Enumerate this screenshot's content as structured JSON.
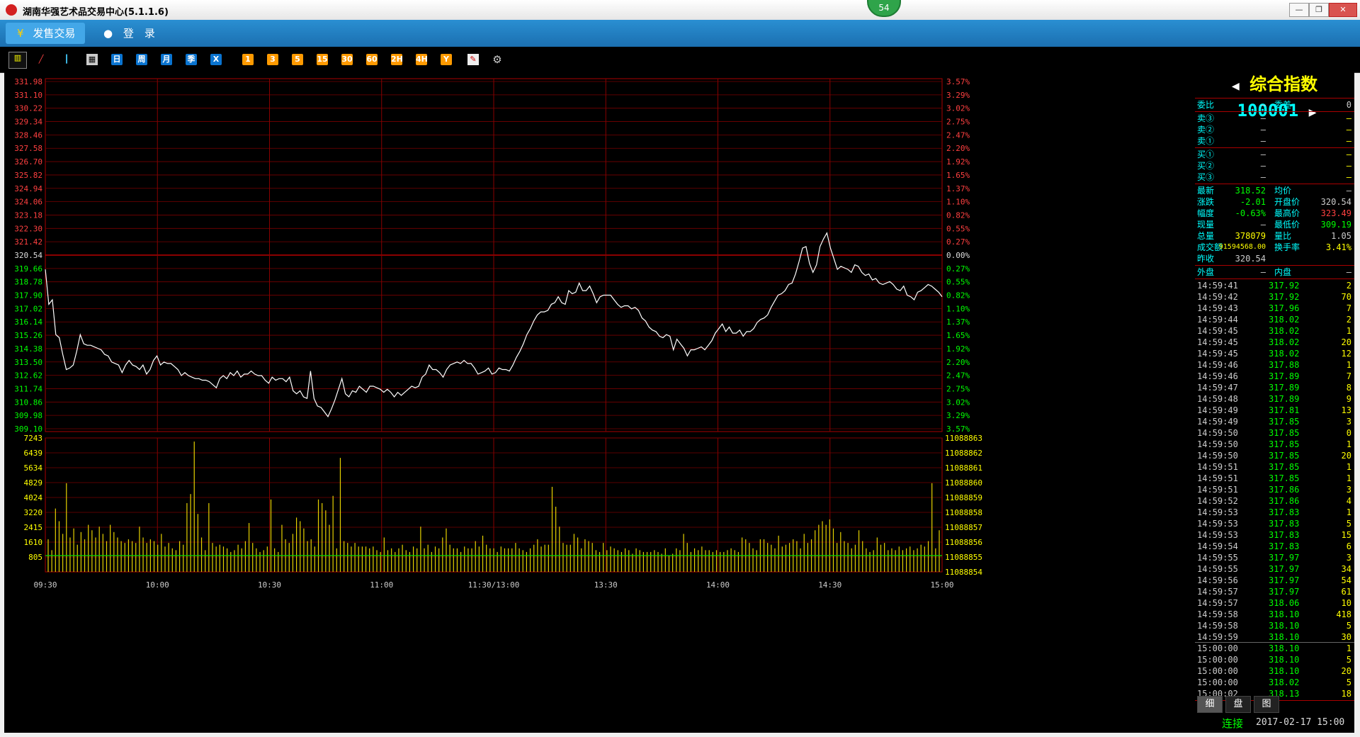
{
  "window": {
    "title": "湖南华强艺术品交易中心(5.1.1.6)",
    "badge": "54"
  },
  "menu": {
    "items": [
      "发售交易",
      "登　录"
    ]
  },
  "toolbar": {
    "period_buttons": [
      "日",
      "周",
      "月",
      "季",
      "X"
    ],
    "minute_buttons": [
      "1",
      "3",
      "5",
      "15",
      "30",
      "60",
      "2H",
      "4H",
      "Y"
    ]
  },
  "chart_data": {
    "type": "line",
    "title": "",
    "x_ticks": [
      "09:30",
      "10:00",
      "10:30",
      "11:00",
      "11:30/13:00",
      "13:30",
      "14:00",
      "14:30",
      "15:00"
    ],
    "price_left_ticks": [
      "331.98",
      "331.10",
      "330.22",
      "329.34",
      "328.46",
      "327.58",
      "326.70",
      "325.82",
      "324.94",
      "324.06",
      "323.18",
      "322.30",
      "321.42",
      "320.54",
      "319.66",
      "318.78",
      "317.90",
      "317.02",
      "316.14",
      "315.26",
      "314.38",
      "313.50",
      "312.62",
      "311.74",
      "310.86",
      "309.98",
      "309.10"
    ],
    "pct_right_ticks": [
      "3.57%",
      "3.29%",
      "3.02%",
      "2.75%",
      "2.47%",
      "2.20%",
      "1.92%",
      "1.65%",
      "1.37%",
      "1.10%",
      "0.82%",
      "0.55%",
      "0.27%",
      "0.00%",
      "0.27%",
      "0.55%",
      "0.82%",
      "1.10%",
      "1.37%",
      "1.65%",
      "1.92%",
      "2.20%",
      "2.47%",
      "2.75%",
      "3.02%",
      "3.29%",
      "3.57%"
    ],
    "vol_left_ticks": [
      "7243",
      "6439",
      "5634",
      "4829",
      "4024",
      "3220",
      "2415",
      "1610",
      "805"
    ],
    "vol_right_ticks": [
      "11088863",
      "11088862",
      "11088861",
      "11088860",
      "11088859",
      "11088858",
      "11088857",
      "11088856",
      "11088855",
      "11088854"
    ],
    "ylim": [
      309.1,
      331.98
    ],
    "prev_close": 320.54,
    "price": [
      319.6,
      317.3,
      317.6,
      315.3,
      315.1,
      314.0,
      313.0,
      313.1,
      313.3,
      314.2,
      315.3,
      314.7,
      314.6,
      314.6,
      314.5,
      314.4,
      314.3,
      314.0,
      313.9,
      313.5,
      313.4,
      313.3,
      312.8,
      313.3,
      313.6,
      313.3,
      313.2,
      313.0,
      313.3,
      312.7,
      313.0,
      313.6,
      313.9,
      313.3,
      313.5,
      313.4,
      313.4,
      313.2,
      313.0,
      312.6,
      312.8,
      312.6,
      312.5,
      312.4,
      312.4,
      312.3,
      312.3,
      312.2,
      312.0,
      311.8,
      312.4,
      312.6,
      312.4,
      312.8,
      312.6,
      312.9,
      312.5,
      312.7,
      312.7,
      312.9,
      312.7,
      312.6,
      312.6,
      312.3,
      312.1,
      312.5,
      312.3,
      312.4,
      312.4,
      312.2,
      312.5,
      311.6,
      311.4,
      311.6,
      311.2,
      311.1,
      312.9,
      311.1,
      310.6,
      310.5,
      310.2,
      309.9,
      310.4,
      311.0,
      311.7,
      312.4,
      311.4,
      311.2,
      311.6,
      311.5,
      311.9,
      311.7,
      311.5,
      311.9,
      311.9,
      311.8,
      311.7,
      311.5,
      311.7,
      311.5,
      311.2,
      311.5,
      311.3,
      311.5,
      311.7,
      311.9,
      311.8,
      311.9,
      312.5,
      312.7,
      313.3,
      313.0,
      313.0,
      312.8,
      312.5,
      313.0,
      313.3,
      313.4,
      313.5,
      313.4,
      313.6,
      313.4,
      313.4,
      313.1,
      312.7,
      312.8,
      312.9,
      313.1,
      312.7,
      312.8,
      313.1,
      313.0,
      313.0,
      312.9,
      313.3,
      313.8,
      314.2,
      314.7,
      315.3,
      315.7,
      316.2,
      316.6,
      316.8,
      316.8,
      316.9,
      317.3,
      317.4,
      317.8,
      317.4,
      317.3,
      318.2,
      318.0,
      318.1,
      318.7,
      318.2,
      318.2,
      318.5,
      318.0,
      317.4,
      317.8,
      317.9,
      317.9,
      317.9,
      317.6,
      317.3,
      317.1,
      317.2,
      317.2,
      317.0,
      317.1,
      316.9,
      316.4,
      316.2,
      315.8,
      315.6,
      315.5,
      315.2,
      315.1,
      315.3,
      315.2,
      314.3,
      315.0,
      314.7,
      314.4,
      313.9,
      314.3,
      314.3,
      314.4,
      314.5,
      314.3,
      314.6,
      314.9,
      315.4,
      315.7,
      316.0,
      315.5,
      315.8,
      315.4,
      315.4,
      315.6,
      315.2,
      315.5,
      315.5,
      315.7,
      316.1,
      316.3,
      316.4,
      316.6,
      317.1,
      317.5,
      317.9,
      318.0,
      318.2,
      318.6,
      318.7,
      319.3,
      320.1,
      321.0,
      321.1,
      320.0,
      319.4,
      319.9,
      321.1,
      321.6,
      322.0,
      321.0,
      320.3,
      319.6,
      319.8,
      319.7,
      319.6,
      319.4,
      319.9,
      319.8,
      319.4,
      319.2,
      319.3,
      318.9,
      319.0,
      318.7,
      318.6,
      318.7,
      318.8,
      318.6,
      318.3,
      318.2,
      318.5,
      317.9,
      317.8,
      317.6,
      318.1,
      318.2,
      318.4,
      318.6,
      318.5,
      318.3,
      318.1,
      317.8
    ],
    "volume": [
      1800,
      1200,
      3500,
      2800,
      2100,
      4900,
      1900,
      2400,
      1500,
      2200,
      1800,
      2600,
      2300,
      1900,
      2500,
      2100,
      1700,
      2600,
      2200,
      1900,
      1700,
      1600,
      1800,
      1700,
      1600,
      2500,
      1900,
      1600,
      1800,
      1700,
      1500,
      2100,
      1400,
      1600,
      1300,
      1200,
      1700,
      1500,
      3800,
      4300,
      7200,
      3200,
      1900,
      1200,
      3800,
      1600,
      1400,
      1500,
      1400,
      1300,
      1100,
      1200,
      1500,
      1300,
      1700,
      2700,
      1600,
      1300,
      1100,
      1200,
      1400,
      4000,
      1300,
      1100,
      2600,
      1800,
      1600,
      2100,
      3000,
      2800,
      2400,
      1700,
      1800,
      1400,
      4000,
      3800,
      3400,
      2600,
      4200,
      1300,
      6300,
      1700,
      1600,
      1400,
      1600,
      1400,
      1400,
      1400,
      1300,
      1400,
      1200,
      1100,
      1900,
      1200,
      1300,
      1100,
      1300,
      1500,
      1200,
      1100,
      1400,
      1300,
      2500,
      1300,
      1500,
      1100,
      1400,
      1300,
      1900,
      2400,
      1500,
      1300,
      1300,
      1100,
      1400,
      1300,
      1300,
      1700,
      1400,
      2000,
      1500,
      1300,
      1300,
      1100,
      1400,
      1300,
      1300,
      1300,
      1600,
      1300,
      1200,
      1100,
      1300,
      1500,
      1800,
      1400,
      1500,
      1500,
      4700,
      3600,
      2500,
      1600,
      1500,
      1500,
      2100,
      1900,
      1300,
      1800,
      1700,
      1600,
      1200,
      1100,
      1600,
      1200,
      1400,
      1300,
      1200,
      1100,
      1300,
      1200,
      1000,
      1300,
      1200,
      1100,
      1100,
      1100,
      1200,
      1100,
      1000,
      1300,
      900,
      1000,
      1300,
      1200,
      2100,
      1600,
      1100,
      1300,
      1200,
      1400,
      1200,
      1200,
      1100,
      1200,
      1100,
      1100,
      1200,
      1300,
      1200,
      1100,
      1900,
      1800,
      1600,
      1300,
      1200,
      1800,
      1800,
      1600,
      1500,
      1300,
      2000,
      1400,
      1500,
      1600,
      1800,
      1700,
      1300,
      2100,
      1600,
      1800,
      2300,
      2600,
      2800,
      2600,
      2900,
      2400,
      1600,
      2200,
      1700,
      1600,
      1300,
      1500,
      2300,
      1700,
      1300,
      1100,
      1200,
      1900,
      1500,
      1600,
      1200,
      1300,
      1200,
      1400,
      1200,
      1300,
      1400,
      1200,
      1300,
      1500,
      1400,
      1700,
      4900,
      1300,
      2300
    ]
  },
  "quote": {
    "name": "综合指数",
    "code": "100001",
    "weibi_label": "委比",
    "weibi_val": "—",
    "weicha_label": "委差",
    "weicha_val": "0",
    "sell": [
      {
        "label": "卖③",
        "p": "—",
        "v": "—"
      },
      {
        "label": "卖②",
        "p": "—",
        "v": "—"
      },
      {
        "label": "卖①",
        "p": "—",
        "v": "—"
      }
    ],
    "buy": [
      {
        "label": "买①",
        "p": "—",
        "v": "—"
      },
      {
        "label": "买②",
        "p": "—",
        "v": "—"
      },
      {
        "label": "买③",
        "p": "—",
        "v": "—"
      }
    ],
    "stats": [
      {
        "l1": "最新",
        "v1": "318.52",
        "l2": "均价",
        "v2": "—",
        "c1": "#0f0",
        "c2": "#ccc"
      },
      {
        "l1": "涨跌",
        "v1": "-2.01",
        "l2": "开盘价",
        "v2": "320.54",
        "c1": "#0f0",
        "c2": "#ccc"
      },
      {
        "l1": "幅度",
        "v1": "-0.63%",
        "l2": "最高价",
        "v2": "323.49",
        "c1": "#0f0",
        "c2": "#ff4040"
      },
      {
        "l1": "现量",
        "v1": "—",
        "l2": "最低价",
        "v2": "309.19",
        "c1": "#ccc",
        "c2": "#0f0"
      },
      {
        "l1": "总量",
        "v1": "378079",
        "l2": "量比",
        "v2": "1.05",
        "c1": "#ff0",
        "c2": "#ccc"
      },
      {
        "l1": "成交额",
        "v1": "91594568.00",
        "l2": "换手率",
        "v2": "3.41%",
        "c1": "#ff0",
        "c2": "#ff0"
      },
      {
        "l1": "昨收",
        "v1": "320.54",
        "l2": "",
        "v2": "",
        "c1": "#ccc",
        "c2": "#ccc"
      }
    ],
    "outer_label": "外盘",
    "outer_val": "—",
    "inner_label": "内盘",
    "inner_val": "—",
    "ticks": [
      [
        "14:59:41",
        "317.92",
        "2"
      ],
      [
        "14:59:42",
        "317.92",
        "70"
      ],
      [
        "14:59:43",
        "317.96",
        "7"
      ],
      [
        "14:59:44",
        "318.02",
        "2"
      ],
      [
        "14:59:45",
        "318.02",
        "1"
      ],
      [
        "14:59:45",
        "318.02",
        "20"
      ],
      [
        "14:59:45",
        "318.02",
        "12"
      ],
      [
        "14:59:46",
        "317.88",
        "1"
      ],
      [
        "14:59:46",
        "317.89",
        "7"
      ],
      [
        "14:59:47",
        "317.89",
        "8"
      ],
      [
        "14:59:48",
        "317.89",
        "9"
      ],
      [
        "14:59:49",
        "317.81",
        "13"
      ],
      [
        "14:59:49",
        "317.85",
        "3"
      ],
      [
        "14:59:50",
        "317.85",
        "0"
      ],
      [
        "14:59:50",
        "317.85",
        "1"
      ],
      [
        "14:59:50",
        "317.85",
        "20"
      ],
      [
        "14:59:51",
        "317.85",
        "1"
      ],
      [
        "14:59:51",
        "317.85",
        "1"
      ],
      [
        "14:59:51",
        "317.86",
        "3"
      ],
      [
        "14:59:52",
        "317.86",
        "4"
      ],
      [
        "14:59:53",
        "317.83",
        "1"
      ],
      [
        "14:59:53",
        "317.83",
        "5"
      ],
      [
        "14:59:53",
        "317.83",
        "15"
      ],
      [
        "14:59:54",
        "317.83",
        "6"
      ],
      [
        "14:59:55",
        "317.97",
        "3"
      ],
      [
        "14:59:55",
        "317.97",
        "34"
      ],
      [
        "14:59:56",
        "317.97",
        "54"
      ],
      [
        "14:59:57",
        "317.97",
        "61"
      ],
      [
        "14:59:57",
        "318.06",
        "10"
      ],
      [
        "14:59:58",
        "318.10",
        "418"
      ],
      [
        "14:59:58",
        "318.10",
        "5"
      ],
      [
        "14:59:59",
        "318.10",
        "30"
      ],
      [
        "15:00:00",
        "318.10",
        "1"
      ],
      [
        "15:00:00",
        "318.10",
        "5"
      ],
      [
        "15:00:00",
        "318.10",
        "20"
      ],
      [
        "15:00:00",
        "318.02",
        "5"
      ],
      [
        "15:00:02",
        "318.13",
        "18"
      ]
    ]
  },
  "bottom_tabs": [
    "细",
    "盘",
    "图"
  ],
  "status": {
    "connection": "连接",
    "datetime": "2017-02-17 15:00"
  }
}
